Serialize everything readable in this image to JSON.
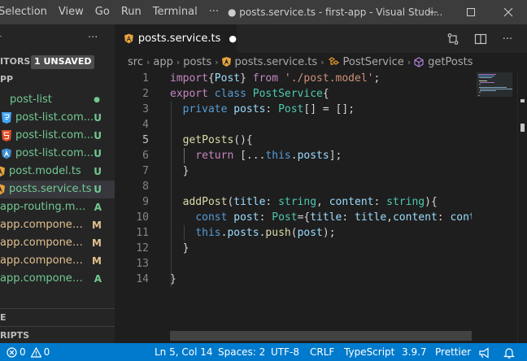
{
  "titlebar": {
    "menu": [
      "Selection",
      "View",
      "Go",
      "Run",
      "Terminal",
      "···"
    ],
    "title": "● posts.service.ts - first-app - Visual Studi..."
  },
  "sidebar": {
    "dots": "···",
    "editors_label": "ITORS",
    "unsaved_badge": "1 UNSAVED",
    "folder_label": "PP",
    "files": [
      {
        "name": "post-list",
        "status": "●",
        "color": "#73c991",
        "icon": "folder",
        "indent": 12
      },
      {
        "name": "post-list.com...",
        "status": "U",
        "color": "#73c991",
        "icon": "css3-icon",
        "indent": 2
      },
      {
        "name": "post-list.com...",
        "status": "U",
        "color": "#73c991",
        "icon": "html5-icon",
        "indent": 2
      },
      {
        "name": "post-list.com...",
        "status": "U",
        "color": "#73c991",
        "icon": "angular-icon",
        "indent": 2
      },
      {
        "name": "post.model.ts",
        "status": "U",
        "color": "#73c991",
        "icon": "angular-icon-partial",
        "indent": 0
      },
      {
        "name": "posts.service.ts",
        "status": "U",
        "color": "#73c991",
        "icon": "angular-icon-partial",
        "indent": 0
      },
      {
        "name": "app-routing.mo...",
        "status": "A",
        "color": "#73c991",
        "icon": "none",
        "indent": 0
      },
      {
        "name": "app.component....",
        "status": "M",
        "color": "#e2c08d",
        "icon": "none",
        "indent": 0
      },
      {
        "name": "app.component....",
        "status": "M",
        "color": "#e2c08d",
        "icon": "none",
        "indent": 0
      },
      {
        "name": "app.component.ts",
        "status": "M",
        "color": "#e2c08d",
        "icon": "none",
        "indent": 0
      },
      {
        "name": "app.component....",
        "status": "A",
        "color": "#73c991",
        "icon": "none",
        "indent": 0
      }
    ],
    "outline_label": "E",
    "scripts_label": "RIPTS"
  },
  "tab": {
    "label": "posts.service.ts",
    "dirty": "●"
  },
  "breadcrumb": {
    "items": [
      "src",
      "app",
      "posts",
      "posts.service.ts",
      "PostService",
      "getPosts"
    ]
  },
  "editor": {
    "lines": [
      {
        "n": "1",
        "tokens": [
          [
            "k",
            "import"
          ],
          [
            "p",
            "{"
          ],
          [
            "v",
            "Post"
          ],
          [
            "p",
            "} "
          ],
          [
            "k",
            "from"
          ],
          [
            "p",
            " "
          ],
          [
            "s",
            "'./post.model'"
          ],
          [
            "p",
            ";"
          ]
        ]
      },
      {
        "n": "2",
        "tokens": [
          [
            "k",
            "export"
          ],
          [
            "p",
            " "
          ],
          [
            "b",
            "class"
          ],
          [
            "p",
            " "
          ],
          [
            "t",
            "PostService"
          ],
          [
            "p",
            "{"
          ]
        ]
      },
      {
        "n": "3",
        "tokens": [
          [
            "p",
            "  "
          ],
          [
            "b",
            "private"
          ],
          [
            "p",
            " "
          ],
          [
            "v",
            "posts"
          ],
          [
            "p",
            ": "
          ],
          [
            "t",
            "Post"
          ],
          [
            "p",
            "[] = [];"
          ]
        ]
      },
      {
        "n": "4",
        "tokens": []
      },
      {
        "n": "5",
        "tokens": [
          [
            "p",
            "  "
          ],
          [
            "f",
            "getPosts"
          ],
          [
            "p",
            "(){"
          ]
        ]
      },
      {
        "n": "6",
        "tokens": [
          [
            "p",
            "    "
          ],
          [
            "k",
            "return"
          ],
          [
            "p",
            " [..."
          ],
          [
            "b",
            "this"
          ],
          [
            "p",
            "."
          ],
          [
            "v",
            "posts"
          ],
          [
            "p",
            "];"
          ]
        ]
      },
      {
        "n": "7",
        "tokens": [
          [
            "p",
            "  }"
          ]
        ]
      },
      {
        "n": "8",
        "tokens": []
      },
      {
        "n": "9",
        "tokens": [
          [
            "p",
            "  "
          ],
          [
            "f",
            "addPost"
          ],
          [
            "p",
            "("
          ],
          [
            "v",
            "title"
          ],
          [
            "p",
            ": "
          ],
          [
            "t",
            "string"
          ],
          [
            "p",
            ", "
          ],
          [
            "v",
            "content"
          ],
          [
            "p",
            ": "
          ],
          [
            "t",
            "string"
          ],
          [
            "p",
            "){"
          ]
        ]
      },
      {
        "n": "10",
        "tokens": [
          [
            "p",
            "    "
          ],
          [
            "b",
            "const"
          ],
          [
            "p",
            " "
          ],
          [
            "v",
            "post"
          ],
          [
            "p",
            ": "
          ],
          [
            "t",
            "Post"
          ],
          [
            "p",
            "={"
          ],
          [
            "v",
            "title"
          ],
          [
            "p",
            ": "
          ],
          [
            "v",
            "title"
          ],
          [
            "p",
            ","
          ],
          [
            "v",
            "content"
          ],
          [
            "p",
            ": "
          ],
          [
            "v",
            "cont"
          ]
        ]
      },
      {
        "n": "11",
        "tokens": [
          [
            "p",
            "    "
          ],
          [
            "b",
            "this"
          ],
          [
            "p",
            "."
          ],
          [
            "v",
            "posts"
          ],
          [
            "p",
            "."
          ],
          [
            "f",
            "push"
          ],
          [
            "p",
            "("
          ],
          [
            "v",
            "post"
          ],
          [
            "p",
            ");"
          ]
        ]
      },
      {
        "n": "12",
        "tokens": [
          [
            "p",
            "  }"
          ]
        ]
      },
      {
        "n": "13",
        "tokens": []
      },
      {
        "n": "14",
        "tokens": [
          [
            "p",
            "}"
          ]
        ]
      }
    ]
  },
  "statusbar": {
    "errors": "0",
    "warnings": "0",
    "position": "Ln 5, Col 14",
    "spaces": "Spaces: 2",
    "encoding": "UTF-8",
    "eol": "CRLF",
    "language": "TypeScript",
    "version": "3.9.7",
    "formatter": "Prettier"
  }
}
